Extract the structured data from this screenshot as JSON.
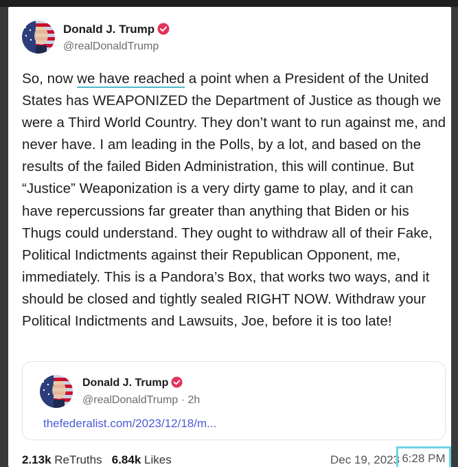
{
  "post": {
    "author": {
      "name": "Donald J. Trump",
      "handle": "@realDonaldTrump"
    },
    "text_parts": {
      "p1": "So, now ",
      "p2": "we have reached",
      "p3": " a point when a President of the United States has WEAPONIZED the Department of Justice as though we were a Third World Country. They don’t want to run against me, and never have. I am leading in the Polls, by a lot, and based on the results of the failed Biden Administration, this will continue. But “Justice” Weaponization is a very dirty game to play, and it can have repercussions far greater than anything that Biden or his Thugs could understand. They ought to withdraw all of their Fake, Political Indictments against their Republican Opponent, me, immediately. This is a Pandora’s Box, that works two ways, and it should be closed and tightly sealed RIGHT NOW. Withdraw your Political Indictments and Lawsuits, Joe, before it is too late!"
    },
    "quoted": {
      "name": "Donald J. Trump",
      "handle_time": "@realDonaldTrump · 2h",
      "link": "thefederalist.com/2023/12/18/m..."
    },
    "stats": {
      "retruths_count": "2.13k",
      "retruths_label": "ReTruths",
      "likes_count": "6.84k",
      "likes_label": "Likes"
    },
    "date": "Dec 19, 2023",
    "time": "6:28 PM"
  },
  "colors": {
    "verified": "#e0345b",
    "link": "#4a5bd6",
    "highlight": "#4fb8c9",
    "time_box": "#6cd3e6"
  },
  "icons": {
    "verified": "verified-badge-icon",
    "avatar": "profile-avatar"
  }
}
